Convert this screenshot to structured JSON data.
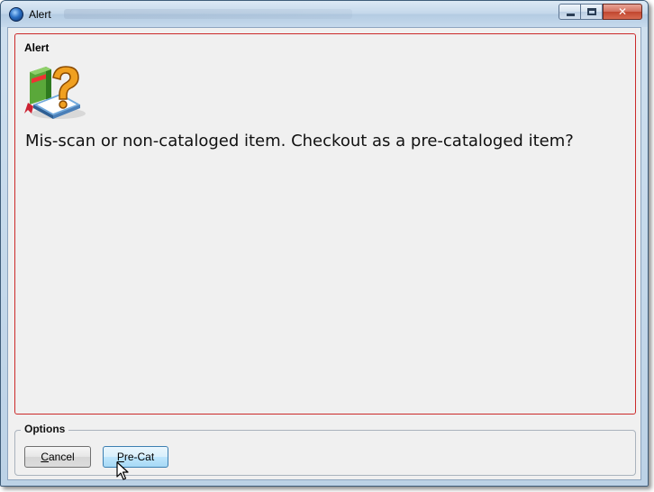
{
  "window": {
    "title": "Alert",
    "title_blurred": true,
    "controls": {
      "minimize_icon": "minimize-icon",
      "maximize_icon": "maximize-icon",
      "close_glyph": "✕"
    }
  },
  "alert": {
    "heading": "Alert",
    "icon": "book-question-icon",
    "message": "Mis-scan or non-cataloged item. Checkout as a pre-cataloged item?"
  },
  "options": {
    "legend": "Options",
    "buttons": [
      {
        "accesskey": "C",
        "rest": "ancel"
      },
      {
        "accesskey": "P",
        "rest": "re-Cat"
      }
    ]
  },
  "colors": {
    "alert_border": "#cc2a2a",
    "focused_button": "#3c7fb1",
    "client_bg": "#f0f0f0"
  }
}
